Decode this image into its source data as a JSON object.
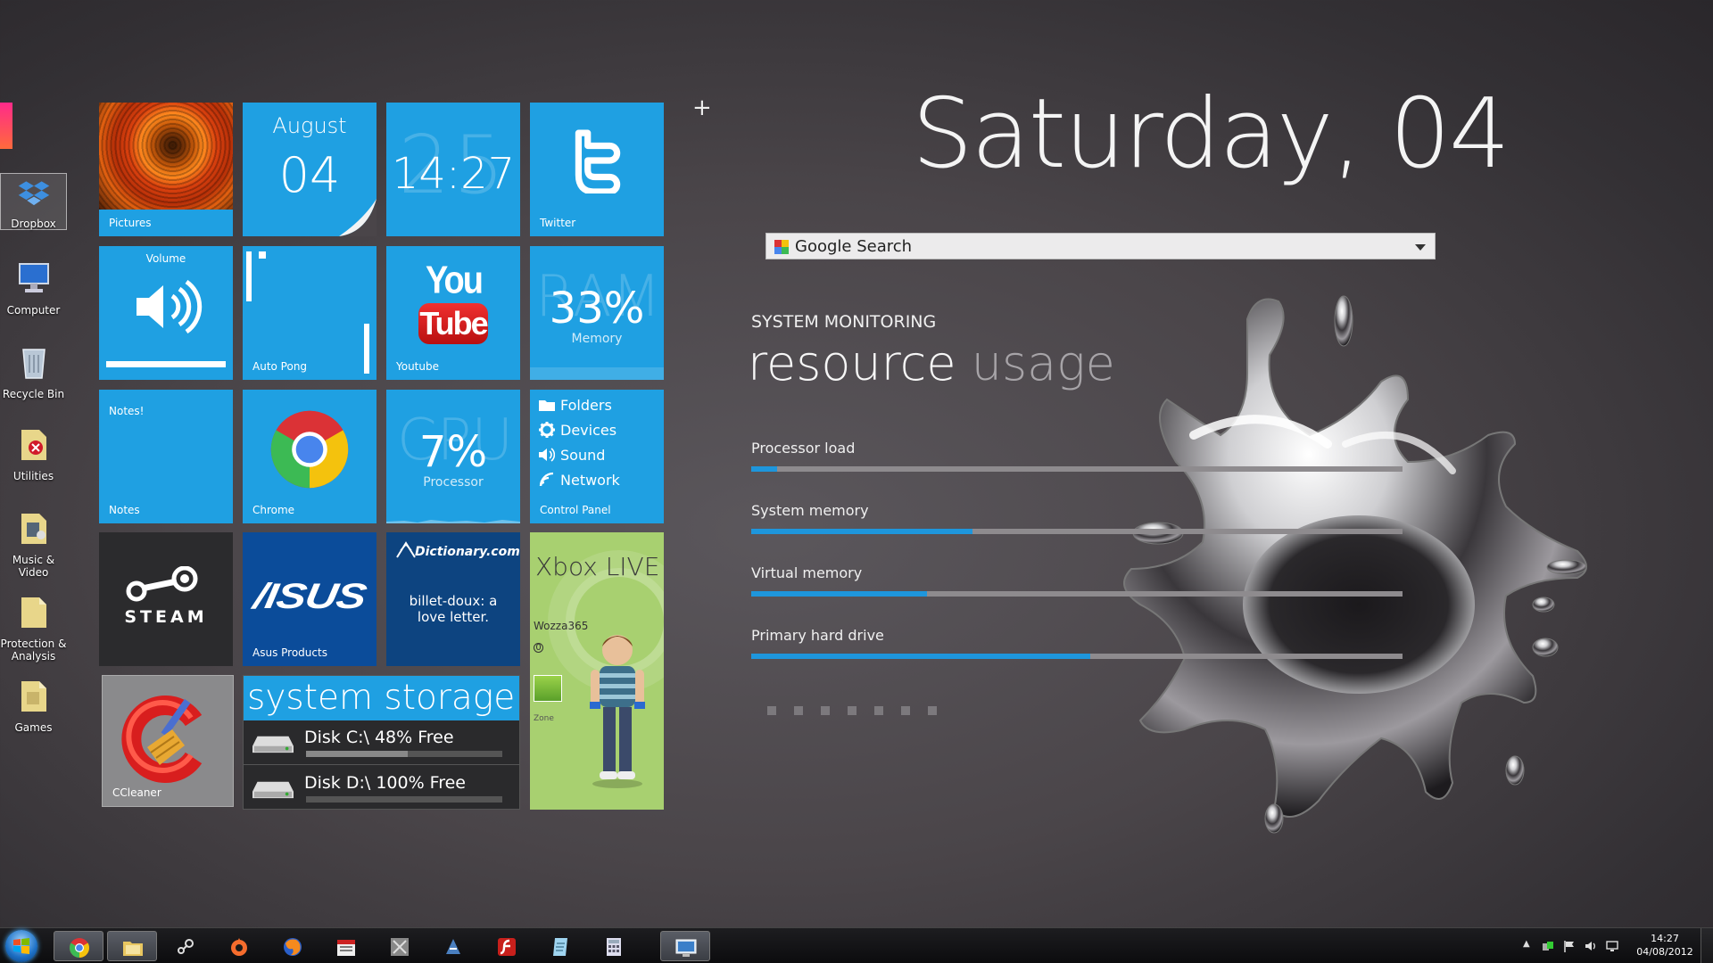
{
  "desktop_icons": [
    {
      "label": "Dropbox",
      "icon": "dropbox-icon"
    },
    {
      "label": "Computer",
      "icon": "computer-icon"
    },
    {
      "label": "Recycle Bin",
      "icon": "recycle-bin-icon"
    },
    {
      "label": "Utilities",
      "icon": "folder-icon"
    },
    {
      "label": "Music &\nVideo",
      "icon": "folder-icon"
    },
    {
      "label": "Protection &\nAnalysis",
      "icon": "folder-icon"
    },
    {
      "label": "Games",
      "icon": "folder-icon"
    }
  ],
  "tiles": {
    "pictures": {
      "label": "Pictures"
    },
    "date": {
      "month": "August",
      "day": "04"
    },
    "clock": {
      "time": "14:27",
      "bg": "25"
    },
    "twitter": {
      "label": "Twitter"
    },
    "volume": {
      "title": "Volume",
      "level_pct": 100
    },
    "autopong": {
      "label": "Auto Pong"
    },
    "youtube": {
      "label": "Youtube",
      "logo_top": "You",
      "logo_bottom": "Tube"
    },
    "ram": {
      "bg": "RAM",
      "value": "33%",
      "label": "Memory"
    },
    "notes": {
      "title": "Notes!",
      "label": "Notes"
    },
    "chrome": {
      "label": "Chrome"
    },
    "cpu": {
      "bg": "CPU",
      "value": "7%",
      "label": "Processor"
    },
    "control_panel": {
      "items": [
        "Folders",
        "Devices",
        "Sound",
        "Network"
      ],
      "label": "Control Panel"
    },
    "steam": {
      "text": "STEAM"
    },
    "asus": {
      "logo": "/ISUS",
      "label": "Asus Products"
    },
    "dictionary": {
      "logo": "Dictionary.com",
      "text": "billet-doux: a love letter."
    },
    "xbox": {
      "title": "Xbox LIVE",
      "gamertag": "Wozza365",
      "score": "0",
      "zone": "Zone"
    },
    "ccleaner": {
      "label": "CCleaner"
    },
    "storage": {
      "title": "system storage",
      "disks": [
        {
          "label": "Disk C:\\ 48% Free",
          "used_pct": 52
        },
        {
          "label": "Disk D:\\ 100% Free",
          "used_pct": 0
        }
      ]
    }
  },
  "plus": "+",
  "date_heading": "Saturday, 04",
  "search": {
    "label": "Google Search"
  },
  "monitor": {
    "caption": "SYSTEM MONITORING",
    "title_a": "resource",
    "title_b": "usage",
    "bars": [
      {
        "label": "Processor load",
        "pct": 4
      },
      {
        "label": "System memory",
        "pct": 34
      },
      {
        "label": "Virtual memory",
        "pct": 27
      },
      {
        "label": "Primary hard drive",
        "pct": 52
      }
    ]
  },
  "taskbar": {
    "apps": [
      "chrome",
      "explorer",
      "steam",
      "origin",
      "firefox",
      "calendar",
      "tools",
      "itunes-like",
      "flash",
      "notes",
      "calculator",
      "remote-desktop"
    ],
    "clock_time": "14:27",
    "clock_date": "04/08/2012"
  },
  "colors": {
    "tile": "#1fa0e2",
    "accent": "#1e96dc"
  }
}
